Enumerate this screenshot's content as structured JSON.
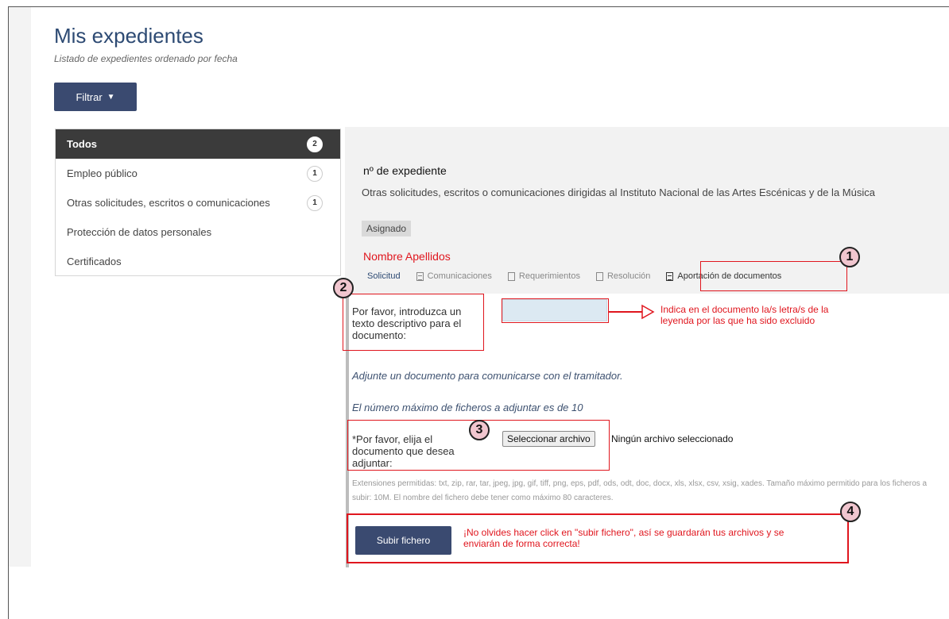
{
  "header": {
    "title": "Mis expedientes",
    "subtitle": "Listado de expedientes ordenado por fecha",
    "filter_label": "Filtrar",
    "filter_caret": "▼"
  },
  "sidebar": {
    "items": [
      {
        "label": "Todos",
        "count": "2"
      },
      {
        "label": "Empleo público",
        "count": "1"
      },
      {
        "label": "Otras solicitudes, escritos o comunicaciones",
        "count": "1"
      },
      {
        "label": "Protección de datos personales",
        "count": ""
      },
      {
        "label": "Certificados",
        "count": ""
      }
    ]
  },
  "expediente": {
    "number_label": "nº de expediente",
    "description": "Otras solicitudes, escritos o comunicaciones dirigidas al Instituto Nacional de las Artes Escénicas y de la Música",
    "status": "Asignado",
    "owner": "Nombre Apellidos"
  },
  "tabs": [
    {
      "label": "Solicitud"
    },
    {
      "label": "Comunicaciones"
    },
    {
      "label": "Requerimientos"
    },
    {
      "label": "Resolución"
    },
    {
      "label": "Aportación de documentos"
    }
  ],
  "form": {
    "description_prompt": "Por favor, introduzca un texto descriptivo para el documento:",
    "description_value": "",
    "attach_hint": "Adjunte un documento para comunicarse con el tramitador.",
    "max_files": "El número máximo de ficheros a adjuntar es de 10",
    "file_prompt": "*Por favor, elija el documento que desea adjuntar:",
    "file_button": "Seleccionar archivo",
    "file_status": "Ningún archivo seleccionado",
    "extensions_note": "Extensiones permitidas: txt, zip, rar, tar, jpeg, jpg, gif, tiff, png, eps, pdf, ods, odt, doc, docx, xls, xlsx, csv, xsig, xades. Tamaño máximo permitido para los ficheros a subir: 10M. El nombre del fichero debe tener como máximo 80 caracteres.",
    "upload_button": "Subir fichero"
  },
  "annotations": {
    "step1": "1",
    "step2": "2",
    "step3": "3",
    "step4": "4",
    "description_note": "Indica en el documento la/s letra/s de la leyenda por las que ha sido excluido",
    "upload_note": "¡No olvides hacer click en \"subir fichero\", así se guardarán tus archivos y se enviarán de forma correcta!"
  },
  "colors": {
    "primary_button": "#3a4a70",
    "annotation_red": "#e0161e",
    "title_blue": "#2d4a73"
  }
}
